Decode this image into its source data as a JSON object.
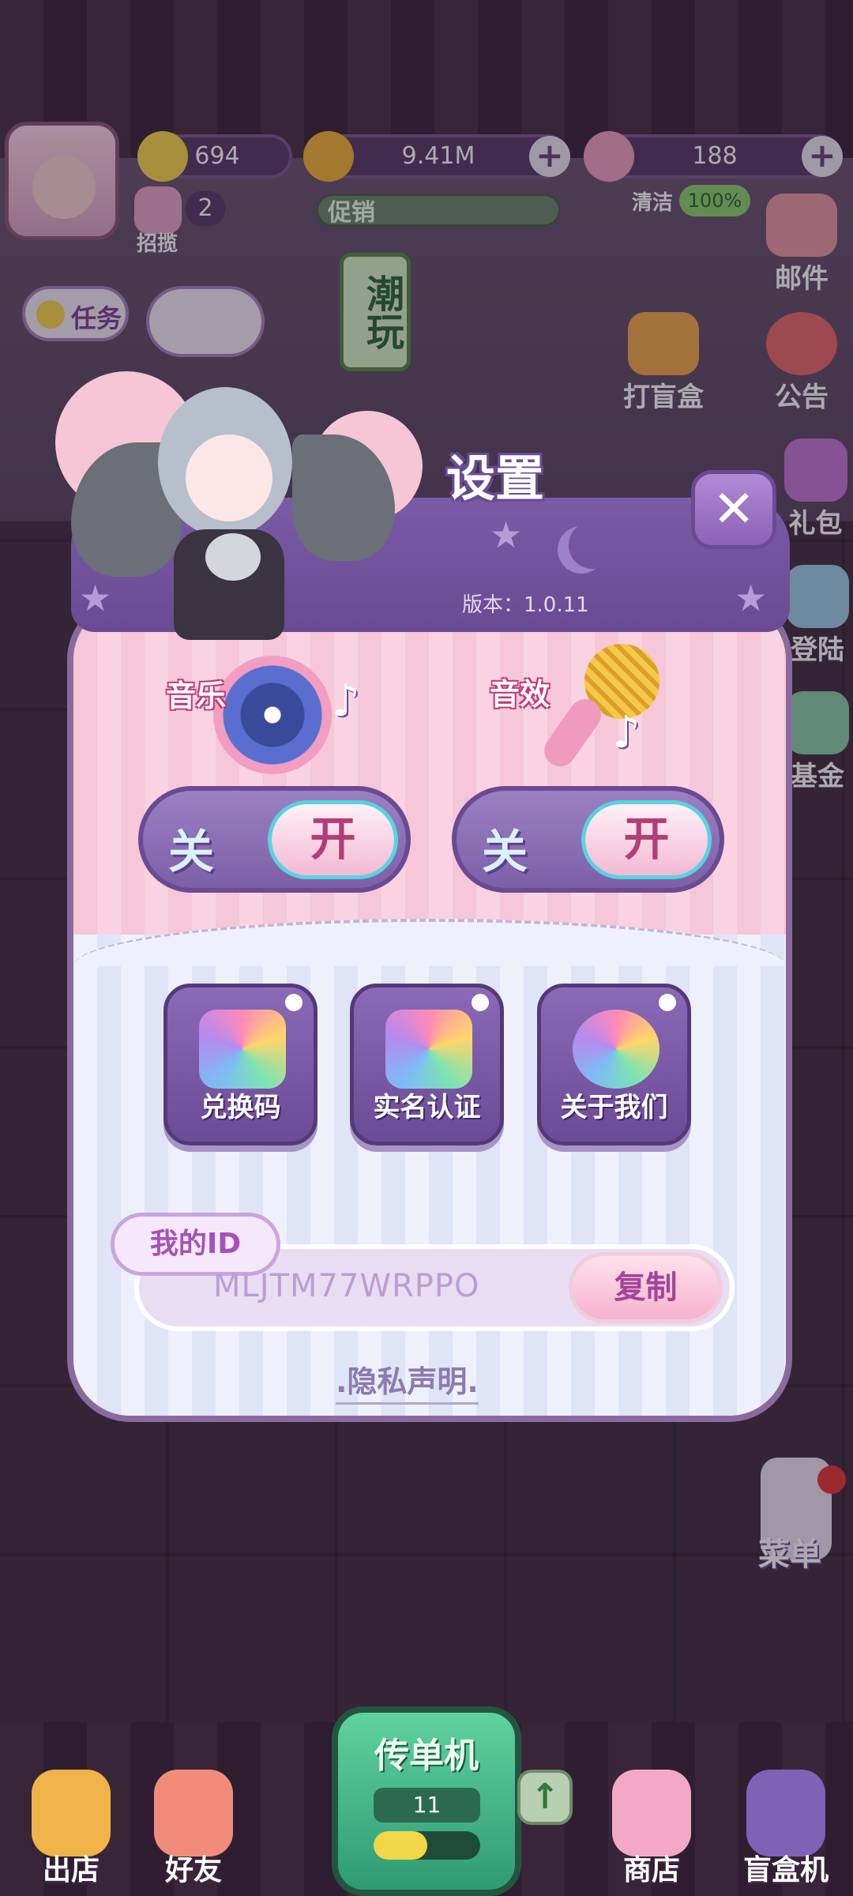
{
  "hud": {
    "stars": "694",
    "coins": "9.41M",
    "gems": "188",
    "recruit_count": "2",
    "recruit_label": "招揽",
    "promo_label": "促销",
    "clean_label": "清洁",
    "clean_pct": "100%"
  },
  "side": {
    "mail": "邮件",
    "notice": "公告",
    "blindbox": "打盲盒",
    "gift": "礼包",
    "login": "登陆",
    "fund": "基金",
    "menu": "菜单",
    "task": "任务",
    "sign_tide": "潮玩"
  },
  "dialog": {
    "title": "设置",
    "version": "版本：1.0.11",
    "music_label": "音乐",
    "sfx_label": "音效",
    "off": "关",
    "on": "开",
    "redeem": "兑换码",
    "realname": "实名认证",
    "about": "关于我们",
    "id_tag": "我的ID",
    "id_value": "MLJTM77WRPPO",
    "copy": "复制",
    "privacy": ".隐私声明."
  },
  "bottom": {
    "leave": "出店",
    "friends": "好友",
    "flyer": "传单机",
    "flyer_count": "11",
    "shop": "商店",
    "blindbox_machine": "盲盒机"
  },
  "colors": {
    "panel_pink": "#f6c7d8",
    "panel_blue": "#eef1fb",
    "purple": "#6a4a93",
    "accent_teal": "#56d4df"
  }
}
